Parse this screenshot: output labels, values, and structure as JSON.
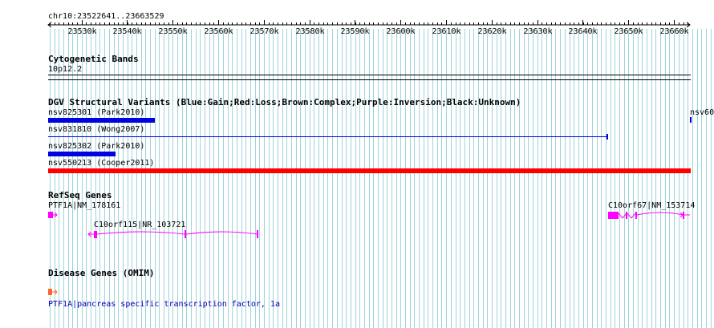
{
  "ruler": {
    "region": "chr10:23522641..23663529",
    "ticks": [
      "23530k",
      "23540k",
      "23550k",
      "23560k",
      "23570k",
      "23580k",
      "23590k",
      "23600k",
      "23610k",
      "23620k",
      "23630k",
      "23640k",
      "23650k",
      "23660k"
    ]
  },
  "cytogenetic": {
    "title": "Cytogenetic Bands",
    "band": "10p12.2"
  },
  "dgv": {
    "title": "DGV Structural Variants (Blue:Gain;Red:Loss;Brown:Complex;Purple:Inversion;Black:Unknown)",
    "variants": [
      {
        "label": "nsv825301 (Park2010)",
        "color": "#0000e0"
      },
      {
        "label": "nsv831810 (Wong2007)",
        "color": "#0000e0"
      },
      {
        "label": "nsv825302 (Park2010)",
        "color": "#0000e0"
      },
      {
        "label": "nsv550213 (Cooper2011)",
        "color": "#ff0000"
      }
    ],
    "offscreen_label": "nsv60"
  },
  "refseq": {
    "title": "RefSeq Genes",
    "genes": [
      {
        "label": "PTF1A|NM_178161",
        "color": "#ff00ff"
      },
      {
        "label": "C10orf115|NR_103721",
        "color": "#ff00ff"
      },
      {
        "label": "C10orf67|NM_153714",
        "color": "#ff00ff"
      }
    ]
  },
  "omim": {
    "title": "Disease Genes (OMIM)",
    "gene_label": "PTF1A|pancreas specific transcription factor, 1a",
    "color": "#ff6633"
  },
  "colors": {
    "grid": "#9fd3dc",
    "ruler": "#000000",
    "link": "#0000b4"
  }
}
